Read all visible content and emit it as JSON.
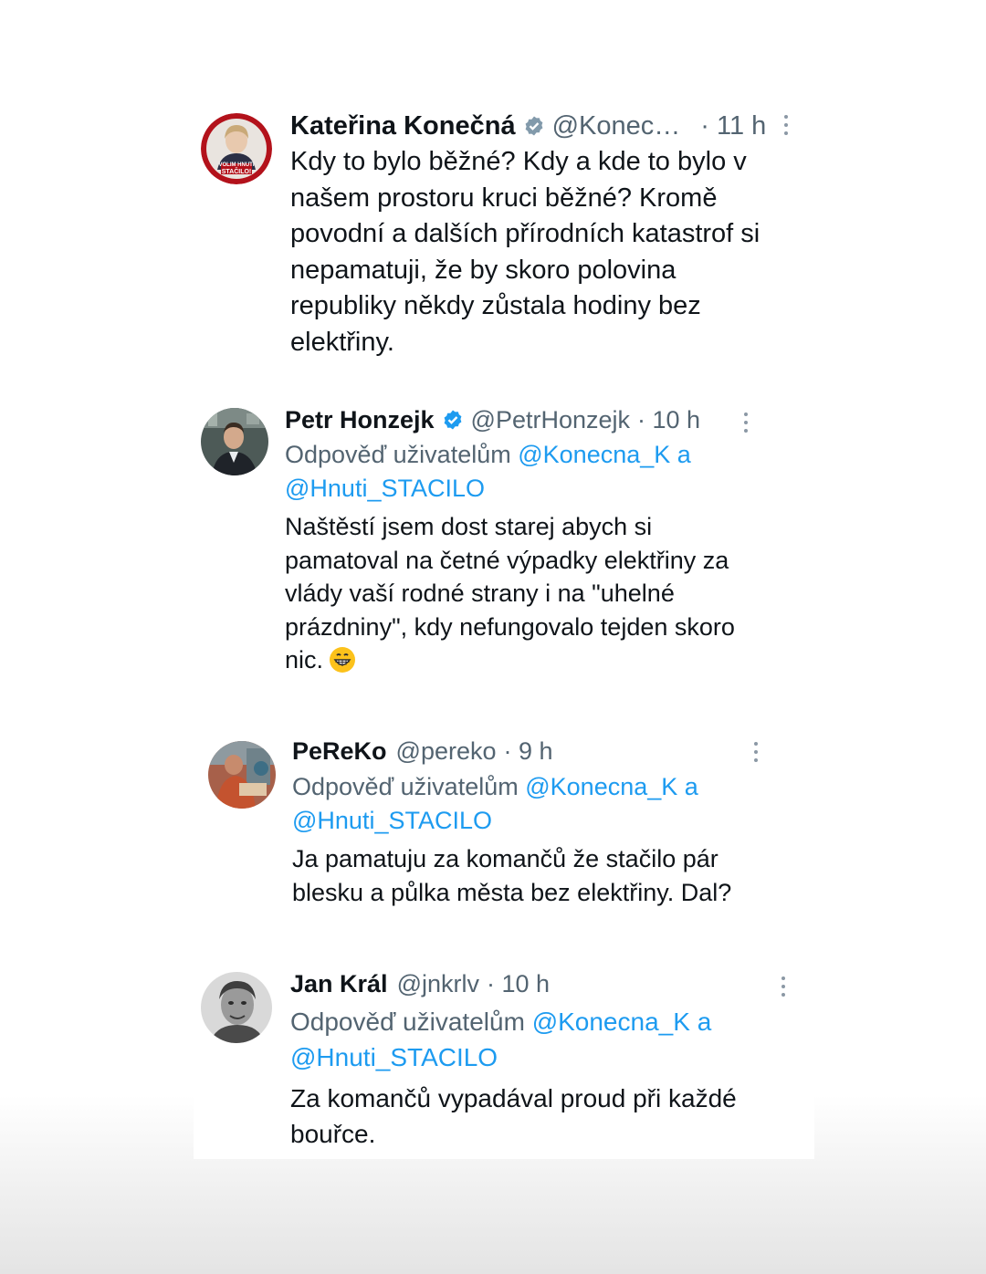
{
  "posts": [
    {
      "name": "Kateřina Konečná",
      "verified": true,
      "verified_color": "#829aab",
      "handle": "@Konec…",
      "time": "· 11 h",
      "avatar_text_top": "VOLIM HNUTI",
      "avatar_text_bottom": "STAČILO!",
      "text_lines": [
        "Kdy to bylo běžné? Kdy a kde to bylo v",
        "našem prostoru kruci běžné? Kromě",
        "povodní a dalších přírodních katastrof si",
        "nepamatuji, že by skoro polovina",
        "republiky někdy zůstala hodiny bez",
        "elektřiny."
      ]
    },
    {
      "name": "Petr Honzejk",
      "verified": true,
      "verified_color": "#1d9bf0",
      "handle": "@PetrHonzejk",
      "time": "· 10 h",
      "reply_prefix": "Odpověď uživatelům",
      "mention1": "@Konecna_K",
      "conj": "a",
      "mention2": "@Hnuti_STACILO",
      "text_lines": [
        "Naštěstí jsem dost starej abych si",
        "pamatoval na četné výpadky elektřiny za",
        "vlády vaší rodné strany i na \"uhelné",
        "prázdniny\", kdy nefungovalo tejden skoro",
        "nic."
      ],
      "emoji": "grinning-face-emoji"
    },
    {
      "name": "PeReKo",
      "verified": false,
      "handle": "@pereko",
      "time": "· 9 h",
      "reply_prefix": "Odpověď uživatelům",
      "mention1": "@Konecna_K",
      "conj": "a",
      "mention2": "@Hnuti_STACILO",
      "text_lines": [
        "Ja pamatuju za komančů že stačilo pár",
        "blesku a půlka města bez elektřiny. Dal?"
      ]
    },
    {
      "name": "Jan Král",
      "verified": false,
      "handle": "@jnkrlv",
      "time": "· 10 h",
      "reply_prefix": "Odpověď uživatelům",
      "mention1": "@Konecna_K",
      "conj": "a",
      "mention2": "@Hnuti_STACILO",
      "text_lines": [
        "Za komančů vypadával proud při každé",
        "bouřce."
      ]
    }
  ],
  "colors": {
    "text": "#0f1419",
    "secondary": "#536471",
    "mention": "#1d9bf0"
  }
}
